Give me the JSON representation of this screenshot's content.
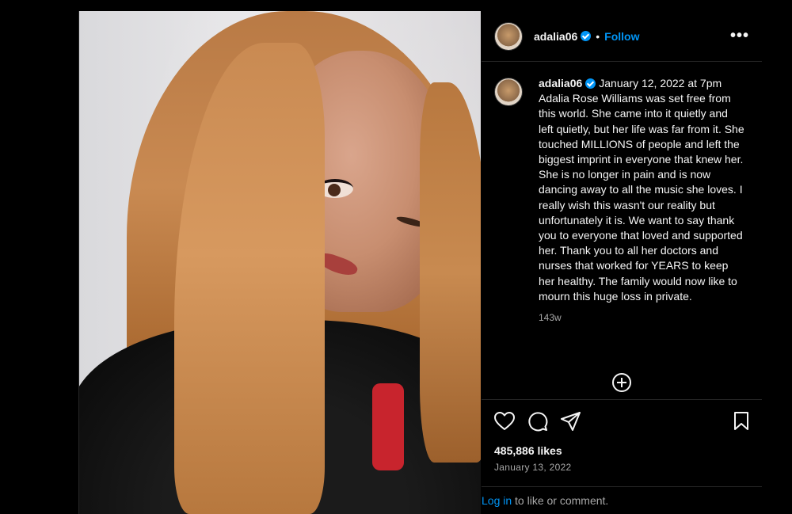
{
  "account": {
    "username": "adalia06",
    "verified": true,
    "follow_label": "Follow",
    "separator": "•",
    "more_label": "•••"
  },
  "caption": {
    "username": "adalia06",
    "date": "January 12, 2022 at 7pm",
    "text": "Adalia Rose Williams was set free from this world. She came into it quietly and left quietly, but her life was far from it. She touched MILLIONS of people and left the biggest imprint in everyone that knew her. She is no longer in pain and is now dancing away to all the music she loves. I really wish this wasn't our reality but unfortunately it is. We want to say thank you to everyone that loved and supported her. Thank you to all her doctors and nurses that worked for YEARS to keep her healthy. The family would now like to mourn this huge loss in private.",
    "time_ago": "143w"
  },
  "icons": {
    "like": "heart-icon",
    "comment": "comment-icon",
    "share": "share-icon",
    "save": "bookmark-icon",
    "more_comments": "plus-circle-icon"
  },
  "stats": {
    "likes": "485,886 likes",
    "post_date": "January 13, 2022"
  },
  "login": {
    "link_text": "Log in",
    "rest_text": " to like or comment."
  },
  "colors": {
    "accent": "#0095f6",
    "background": "#000000",
    "muted_text": "#a8a8a8"
  }
}
